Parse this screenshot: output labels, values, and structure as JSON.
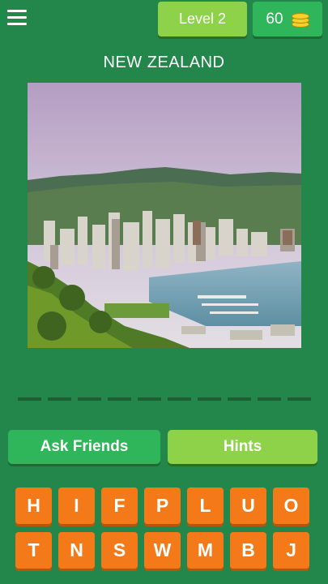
{
  "header": {
    "level_label": "Level 2",
    "coins": "60",
    "menu_icon": "hamburger-menu-icon",
    "coin_icon": "gold-coins-icon"
  },
  "puzzle": {
    "title": "NEW ZEALAND",
    "answer_slots": 10
  },
  "actions": {
    "ask_friends": "Ask Friends",
    "hints": "Hints"
  },
  "keyboard": {
    "row1": [
      "H",
      "I",
      "F",
      "P",
      "L",
      "U",
      "O"
    ],
    "row2": [
      "T",
      "N",
      "S",
      "W",
      "M",
      "B",
      "J"
    ]
  },
  "colors": {
    "background": "#23864a",
    "level_pill": "#8ed24a",
    "coin_pill": "#2fb55a",
    "key": "#f47a19"
  }
}
